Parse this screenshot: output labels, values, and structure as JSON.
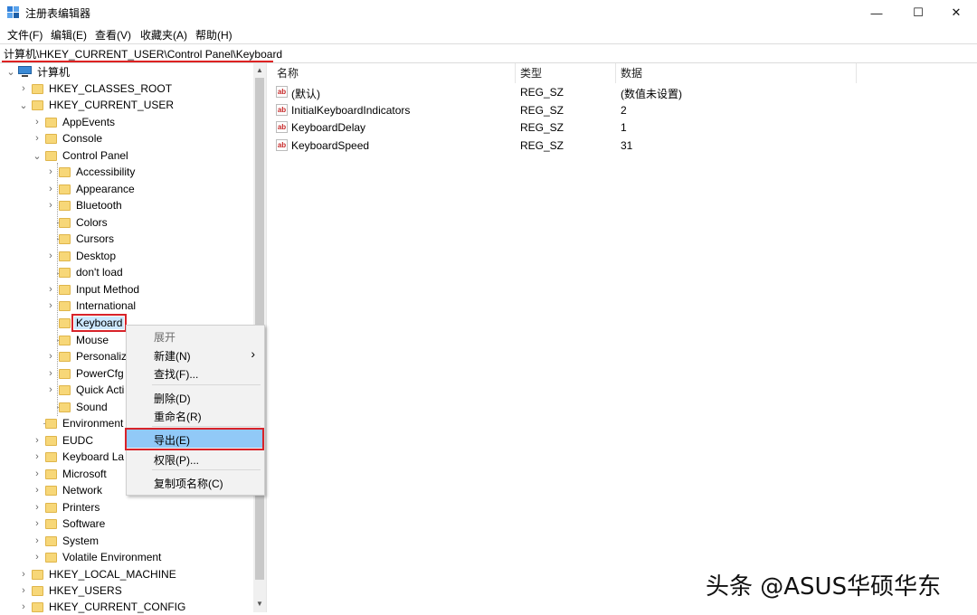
{
  "window": {
    "title": "注册表编辑器",
    "minimize_glyph": "—",
    "maximize_glyph": "☐",
    "close_glyph": "✕"
  },
  "menu": [
    "文件(F)",
    "编辑(E)",
    "查看(V)",
    "收藏夹(A)",
    "帮助(H)"
  ],
  "address": "计算机\\HKEY_CURRENT_USER\\Control Panel\\Keyboard",
  "tree": {
    "root": "计算机",
    "hives": [
      "HKEY_CLASSES_ROOT",
      "HKEY_CURRENT_USER",
      "HKEY_LOCAL_MACHINE",
      "HKEY_USERS",
      "HKEY_CURRENT_CONFIG"
    ],
    "hkcu_children": [
      "AppEvents",
      "Console",
      "Control Panel",
      "Environment",
      "EUDC",
      "Keyboard La",
      "Microsoft",
      "Network",
      "Printers",
      "Software",
      "System",
      "Volatile Environment"
    ],
    "control_panel_children": [
      "Accessibility",
      "Appearance",
      "Bluetooth",
      "Colors",
      "Cursors",
      "Desktop",
      "don't load",
      "Input Method",
      "International",
      "Keyboard",
      "Mouse",
      "Personaliz",
      "PowerCfg",
      "Quick Acti",
      "Sound"
    ],
    "selected": "Keyboard"
  },
  "list": {
    "headers": {
      "name": "名称",
      "type": "类型",
      "data": "数据"
    },
    "rows": [
      {
        "name": "(默认)",
        "type": "REG_SZ",
        "data": "(数值未设置)"
      },
      {
        "name": "InitialKeyboardIndicators",
        "type": "REG_SZ",
        "data": "2"
      },
      {
        "name": "KeyboardDelay",
        "type": "REG_SZ",
        "data": "1"
      },
      {
        "name": "KeyboardSpeed",
        "type": "REG_SZ",
        "data": "31"
      }
    ]
  },
  "context_menu": {
    "expand": "展开",
    "new": "新建(N)",
    "find": "查找(F)...",
    "delete": "删除(D)",
    "rename": "重命名(R)",
    "export": "导出(E)",
    "permissions": "权限(P)...",
    "copy_key_name": "复制项名称(C)",
    "submenu_glyph": "›"
  },
  "watermark": "头条 @ASUS华硕华东",
  "colors": {
    "highlight": "#91c9f7",
    "annotation_red": "#d8232a",
    "folder": "#f7d778"
  }
}
